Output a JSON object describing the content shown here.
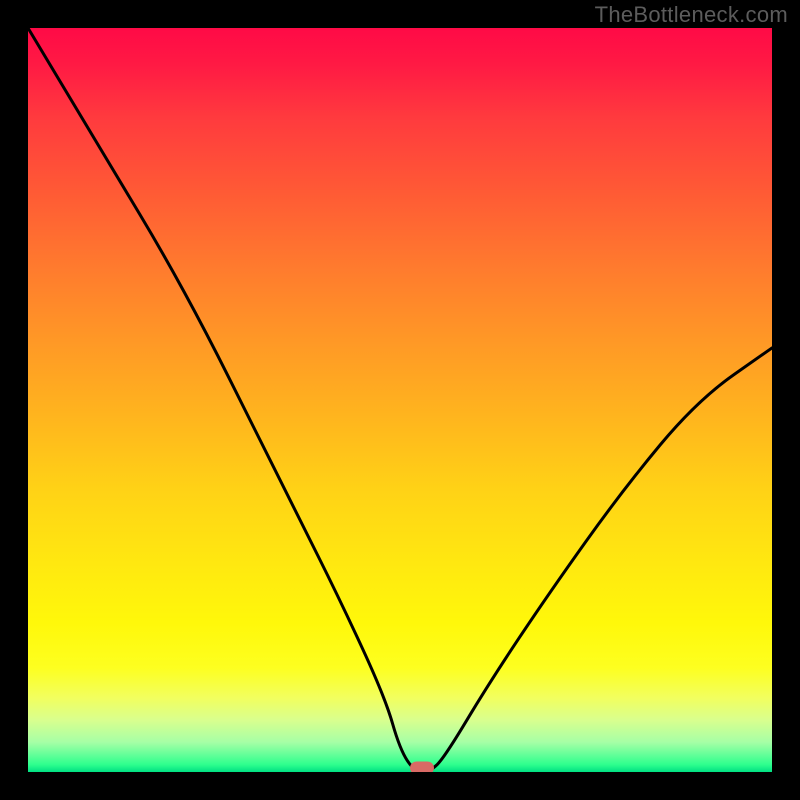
{
  "watermark": "TheBottleneck.com",
  "colors": {
    "frame_bg": "#000000",
    "curve": "#000000",
    "marker": "#d96a65",
    "watermark_text": "#5c5c5c"
  },
  "chart_data": {
    "type": "line",
    "title": "",
    "xlabel": "",
    "ylabel": "",
    "xlim": [
      0,
      100
    ],
    "ylim": [
      0,
      100
    ],
    "grid": false,
    "legend": false,
    "series": [
      {
        "name": "bottleneck-curve",
        "x": [
          0,
          6,
          12,
          18,
          24,
          30,
          36,
          42,
          48,
          50,
          52,
          54,
          56,
          62,
          70,
          80,
          90,
          100
        ],
        "values": [
          100,
          90,
          80,
          70,
          59,
          47,
          35,
          23,
          10,
          3,
          0,
          0,
          2,
          12,
          24,
          38,
          50,
          57
        ]
      }
    ],
    "marker": {
      "x": 53,
      "y": 0
    }
  }
}
